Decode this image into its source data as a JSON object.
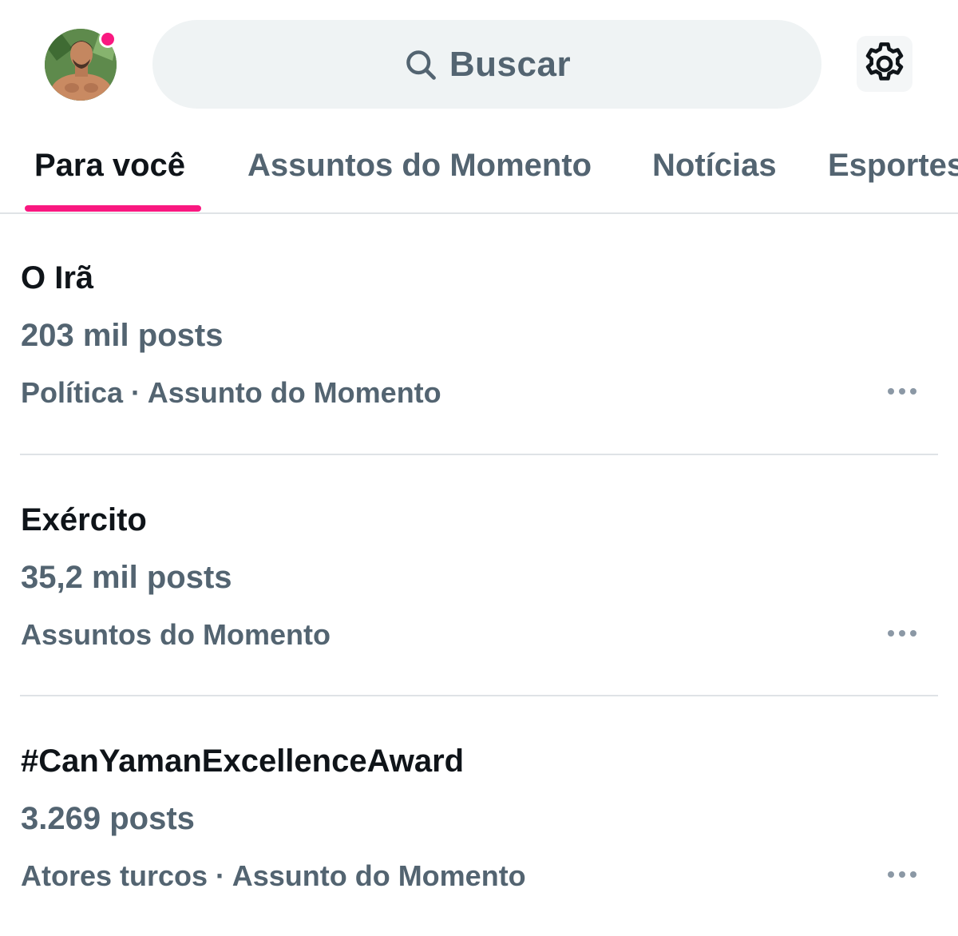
{
  "header": {
    "avatar_alt": "Foto de perfil",
    "search": {
      "placeholder": "Buscar",
      "icon": "search-icon"
    },
    "settings": {
      "icon": "gear-icon"
    },
    "notification_dot_color": "#f91880"
  },
  "tabs": [
    {
      "label": "Para você",
      "active": true
    },
    {
      "label": "Assuntos do Momento",
      "active": false
    },
    {
      "label": "Notícias",
      "active": false
    },
    {
      "label": "Esportes",
      "active": false
    }
  ],
  "trends": [
    {
      "title": "O Irã",
      "count": "203 mil posts",
      "meta": "Política · Assunto do Momento"
    },
    {
      "title": "Exército",
      "count": "35,2 mil posts",
      "meta": "Assuntos do Momento"
    },
    {
      "title": "#CanYamanExcellenceAward",
      "count": "3.269 posts",
      "meta": "Atores turcos · Assunto do Momento"
    }
  ],
  "colors": {
    "accent": "#f91880",
    "primary_text": "#0f1419",
    "secondary_text": "#536471",
    "search_bg": "#eff3f4",
    "divider": "#dfe3e6"
  }
}
